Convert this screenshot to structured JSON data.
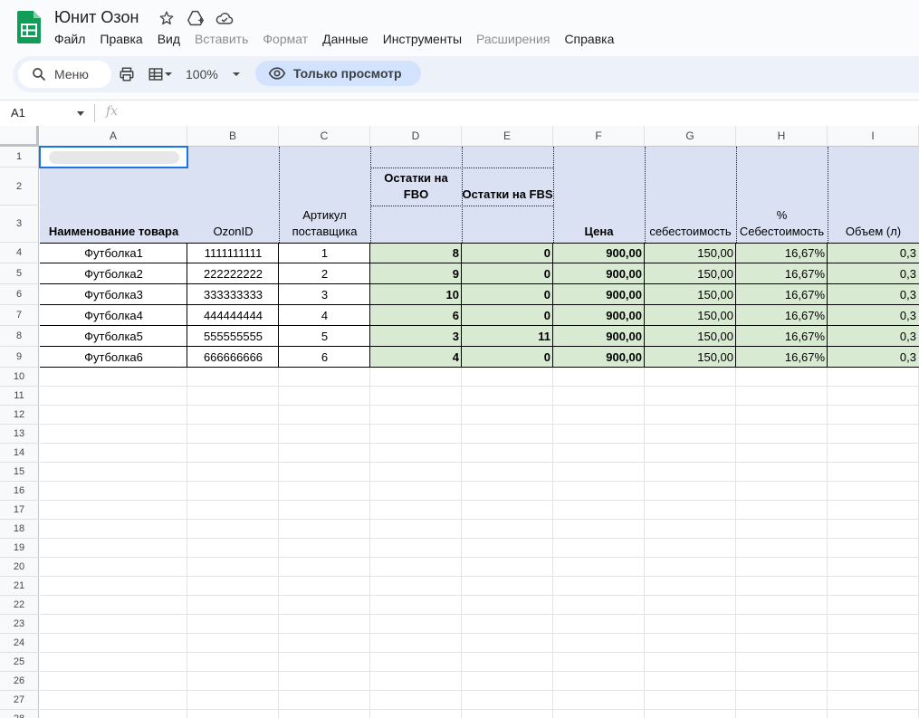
{
  "app": {
    "title": "Юнит Озон",
    "menu": [
      {
        "label": "Файл",
        "disabled": false
      },
      {
        "label": "Правка",
        "disabled": false
      },
      {
        "label": "Вид",
        "disabled": false
      },
      {
        "label": "Вставить",
        "disabled": true
      },
      {
        "label": "Формат",
        "disabled": true
      },
      {
        "label": "Данные",
        "disabled": false
      },
      {
        "label": "Инструменты",
        "disabled": false
      },
      {
        "label": "Расширения",
        "disabled": true
      },
      {
        "label": "Справка",
        "disabled": false
      }
    ]
  },
  "toolbar": {
    "search_label": "Меню",
    "zoom": "100%",
    "view_only_label": "Только просмотр"
  },
  "formula_bar": {
    "name_box": "A1",
    "fx_label": "fx"
  },
  "sheet": {
    "columns": [
      "A",
      "B",
      "C",
      "D",
      "E",
      "F",
      "G",
      "H",
      "I"
    ],
    "row_numbers": [
      "1",
      "2",
      "3",
      "4",
      "5",
      "6",
      "7",
      "8",
      "9",
      "10",
      "11",
      "12",
      "13",
      "14",
      "15",
      "16",
      "17",
      "18",
      "19",
      "20",
      "21",
      "22",
      "23",
      "24",
      "25",
      "26",
      "27",
      "28"
    ],
    "headers": {
      "name": "Наименование товара",
      "ozon_id": "OzonID",
      "article_line1": "Артикул",
      "article_line2": "поставщика",
      "fbo_line1": "Остатки на",
      "fbo_line2": "FBO",
      "fbs": "Остатки на FBS",
      "price": "Цена",
      "cost": "себестоимость",
      "cost_pct_line1": "%",
      "cost_pct_line2": "Себестоимость",
      "volume": "Объем (л)"
    },
    "rows": [
      {
        "name": "Футболка1",
        "ozon_id": "1111111111",
        "article": "1",
        "fbo": "8",
        "fbs": "0",
        "price": "900,00",
        "cost": "150,00",
        "cost_pct": "16,67%",
        "volume": "0,3"
      },
      {
        "name": "Футболка2",
        "ozon_id": "222222222",
        "article": "2",
        "fbo": "9",
        "fbs": "0",
        "price": "900,00",
        "cost": "150,00",
        "cost_pct": "16,67%",
        "volume": "0,3"
      },
      {
        "name": "Футболка3",
        "ozon_id": "333333333",
        "article": "3",
        "fbo": "10",
        "fbs": "0",
        "price": "900,00",
        "cost": "150,00",
        "cost_pct": "16,67%",
        "volume": "0,3"
      },
      {
        "name": "Футболка4",
        "ozon_id": "444444444",
        "article": "4",
        "fbo": "6",
        "fbs": "0",
        "price": "900,00",
        "cost": "150,00",
        "cost_pct": "16,67%",
        "volume": "0,3"
      },
      {
        "name": "Футболка5",
        "ozon_id": "555555555",
        "article": "5",
        "fbo": "3",
        "fbs": "11",
        "price": "900,00",
        "cost": "150,00",
        "cost_pct": "16,67%",
        "volume": "0,3"
      },
      {
        "name": "Футболка6",
        "ozon_id": "666666666",
        "article": "6",
        "fbo": "4",
        "fbs": "0",
        "price": "900,00",
        "cost": "150,00",
        "cost_pct": "16,67%",
        "volume": "0,3"
      }
    ]
  },
  "colors": {
    "header_fill": "#dae1f2",
    "data_fill": "#d9ead3",
    "selection": "#1a73e8",
    "view_only_pill": "#d3e3fd",
    "logo_green": "#0f9d58"
  },
  "icons": [
    "sheets-logo-icon",
    "star-icon",
    "move-to-drive-icon",
    "cloud-status-icon",
    "search-icon",
    "print-icon",
    "table-format-icon",
    "chevron-down-icon",
    "eye-icon",
    "fx-icon"
  ]
}
